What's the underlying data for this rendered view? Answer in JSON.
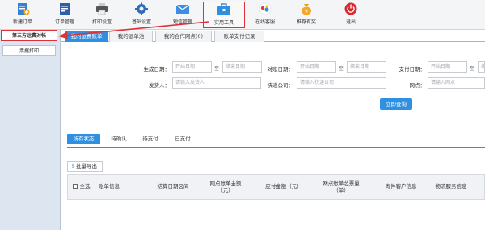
{
  "toolbar": {
    "items": [
      {
        "label": "新建订单",
        "icon": "new-order-icon"
      },
      {
        "label": "订单管理",
        "icon": "order-manage-icon"
      },
      {
        "label": "打印设置",
        "icon": "printer-icon"
      },
      {
        "label": "基础设置",
        "icon": "gear-icon"
      },
      {
        "label": "短信管理",
        "icon": "envelope-icon"
      },
      {
        "label": "实用工具",
        "icon": "toolbox-icon"
      },
      {
        "label": "在线客服",
        "icon": "chat-icon"
      },
      {
        "label": "推荐有奖",
        "icon": "money-bag-icon"
      },
      {
        "label": "退出",
        "icon": "power-icon"
      }
    ],
    "active_index": 5
  },
  "left_panel": {
    "items": [
      {
        "label": "第三方运费对帐"
      },
      {
        "label": "票据打印"
      }
    ]
  },
  "tabs": [
    {
      "label": "我的运费账单"
    },
    {
      "label": "我的运单池"
    },
    {
      "label": "我的合作网点(0)"
    },
    {
      "label": "账单支付记录"
    }
  ],
  "form": {
    "gen_date_label": "生成日期：",
    "check_date_label": "对账日期：",
    "pay_date_label": "支付日期：",
    "start_placeholder": "开始日期",
    "end_placeholder": "结束日期",
    "to": "至",
    "sender_label": "发货人：",
    "sender_placeholder": "请输入发货人",
    "express_label": "快递公司：",
    "express_placeholder": "请输入快递公司",
    "outlet_label": "网点：",
    "outlet_placeholder": "请输入网点",
    "query_button": "立即查询"
  },
  "status_tabs": [
    {
      "label": "所有状态"
    },
    {
      "label": "待确认"
    },
    {
      "label": "待支付"
    },
    {
      "label": "已支付"
    }
  ],
  "export_button": "批量导出",
  "table": {
    "select_all": "全选",
    "columns": [
      "账单信息",
      "结算日期区间",
      "网点账单金额（元）",
      "应付金额（元）",
      "网点账单总票量（单）",
      "寄件客户信息",
      "物流服务信息"
    ]
  },
  "colors": {
    "accent": "#2f8fe0",
    "annotation": "#e0303a"
  }
}
